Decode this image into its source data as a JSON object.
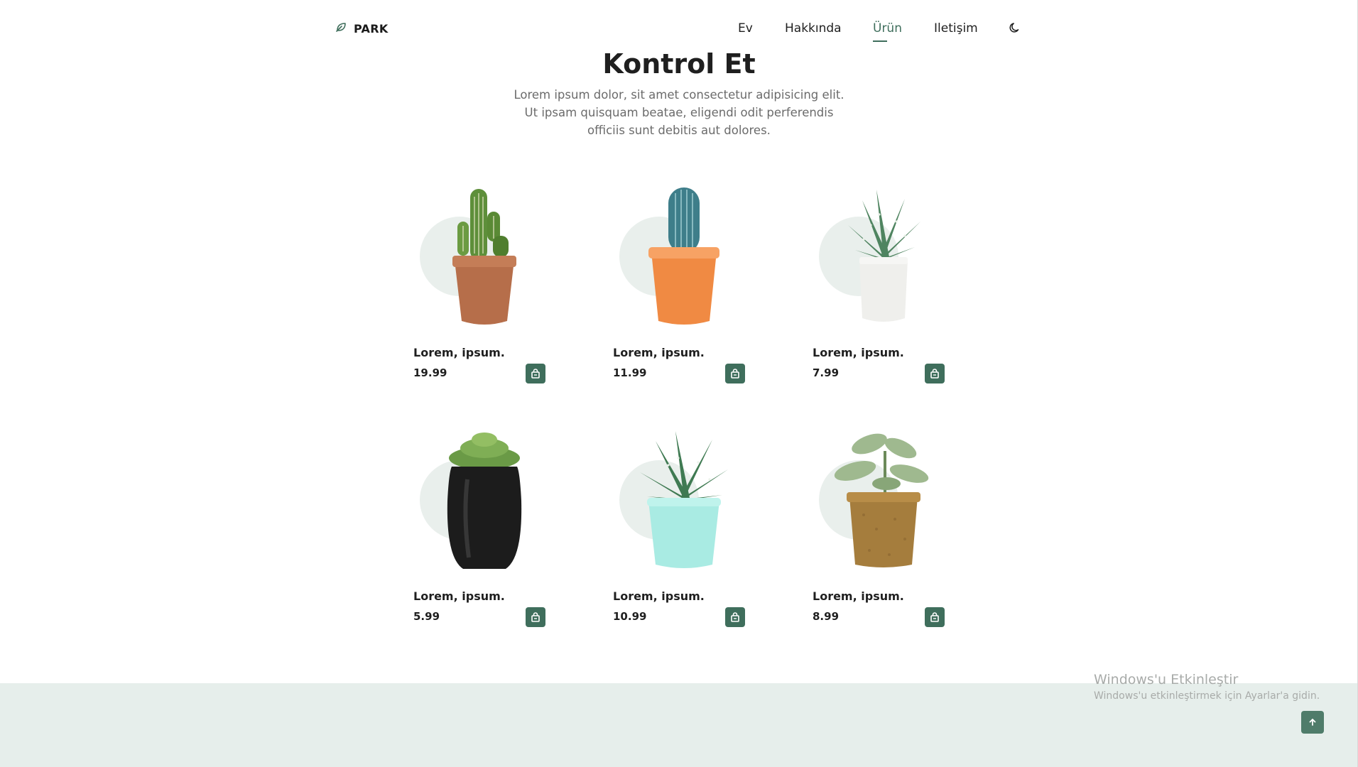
{
  "brand": {
    "name": "PARK"
  },
  "nav": {
    "items": [
      {
        "label": "Ev"
      },
      {
        "label": "Hakkında"
      },
      {
        "label": "Ürün"
      },
      {
        "label": "Iletişim"
      }
    ],
    "active": "Ürün"
  },
  "hero": {
    "title": "Kontrol Et",
    "subtitle_lines": [
      "Lorem ipsum dolor, sit amet consectetur adipisicing elit.",
      "Ut ipsam quisquam beatae, eligendi odit perferendis",
      "officiis sunt debitis aut dolores."
    ]
  },
  "products": [
    {
      "name": "Lorem, ipsum.",
      "price": "19.99",
      "plant": "cactus",
      "pot": "terracotta"
    },
    {
      "name": "Lorem, ipsum.",
      "price": "11.99",
      "plant": "blue-cactus",
      "pot": "orange"
    },
    {
      "name": "Lorem, ipsum.",
      "price": "7.99",
      "plant": "aloe",
      "pot": "white"
    },
    {
      "name": "Lorem, ipsum.",
      "price": "5.99",
      "plant": "echeveria",
      "pot": "black"
    },
    {
      "name": "Lorem, ipsum.",
      "price": "10.99",
      "plant": "haworthia",
      "pot": "mint"
    },
    {
      "name": "Lorem, ipsum.",
      "price": "8.99",
      "plant": "kalanchoe",
      "pot": "coir"
    }
  ],
  "watermark": {
    "title": "Windows'u Etkinleştir",
    "subtitle": "Windows'u etkinleştirmek için Ayarlar'a gidin."
  },
  "icons": {
    "logo": "leaf-icon",
    "theme": "moon-icon",
    "cart": "shopping-bag-icon",
    "scroll_top": "arrow-up-icon"
  },
  "colors": {
    "accent": "#3f6e5c",
    "circle": "#e9efec",
    "footer": "#e6eeeb"
  }
}
